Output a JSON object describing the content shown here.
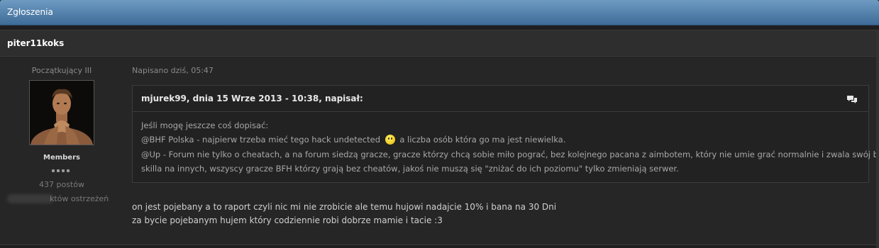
{
  "section": {
    "title": "Zgłoszenia"
  },
  "post": {
    "author": "piter11koks",
    "author_rank": "Początkujący III",
    "author_group": "Members",
    "rank_pips": 4,
    "post_count": "437 postów",
    "warnings_suffix": "któw ostrzeżeń",
    "posted": "Napisano dziś, 05:47",
    "quote": {
      "citation": "mjurek99, dnia 15 Wrze 2013 - 10:38, napisał:",
      "icon": "quote-bubbles-icon",
      "lines": [
        "Jeśli mogę jeszcze coś dopisać:",
        "@BHF Polska - najpierw trzeba mieć tego hack undetected",
        "a liczba osób która go ma jest niewielka.",
        "@Up - Forum nie tylko o cheatach, a na forum siedzą gracze, gracze którzy chcą sobie miło pograć, bez kolejnego pacana z aimbotem, który nie umie grać normalnie i zwala swój brak",
        "skilla na innych, wszyscy gracze BFH którzy grają bez cheatów, jakoś nie muszą się \"zniżać do ich poziomu\" tylko zmieniają serwer."
      ],
      "emoticon": "wink-smiley-icon"
    },
    "message_lines": [
      "on jest pojebany a to raport czyli nic mi nie zrobicie ale temu hujowi nadajcie 10% i bana na 30 Dni",
      "za bycie pojebanym hujem który codziennie robi dobrze mamie i tacie :3"
    ]
  }
}
